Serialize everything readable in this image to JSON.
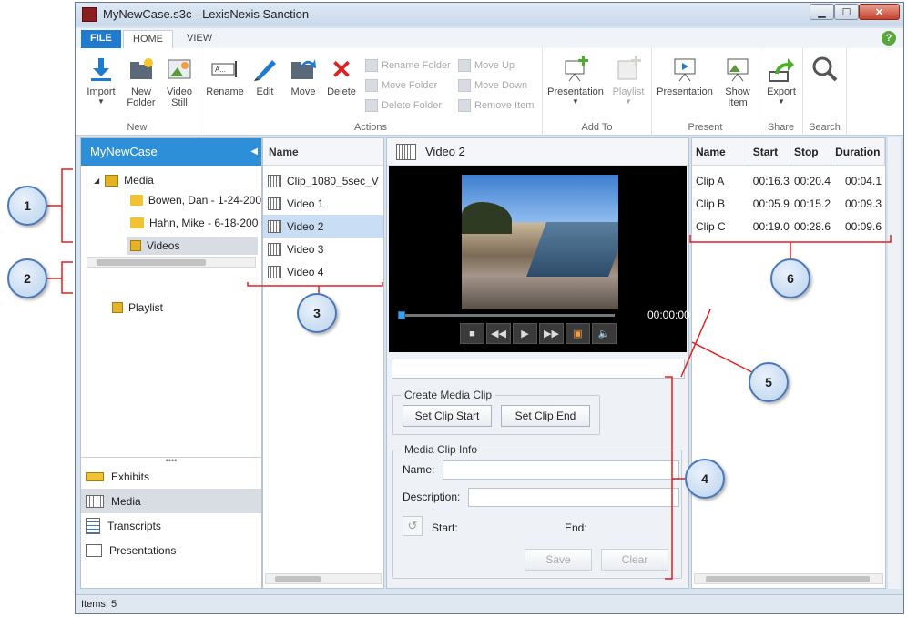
{
  "window": {
    "title": "MyNewCase.s3c - LexisNexis Sanction"
  },
  "tabs": {
    "file": "FILE",
    "home": "HOME",
    "view": "VIEW"
  },
  "ribbon": {
    "new_group": {
      "label": "New",
      "import": "Import",
      "new_folder": "New Folder",
      "video_still": "Video Still"
    },
    "actions_group": {
      "label": "Actions",
      "rename": "Rename",
      "edit": "Edit",
      "move": "Move",
      "delete": "Delete",
      "rename_folder": "Rename Folder",
      "move_folder": "Move Folder",
      "delete_folder": "Delete Folder",
      "move_up": "Move Up",
      "move_down": "Move Down",
      "remove_item": "Remove Item"
    },
    "addto_group": {
      "label": "Add To",
      "presentation": "Presentation",
      "playlist": "Playlist"
    },
    "present_group": {
      "label": "Present",
      "presentation": "Presentation",
      "show_item": "Show Item"
    },
    "share_group": {
      "label": "Share",
      "export": "Export"
    },
    "search_group": {
      "label": "Search"
    }
  },
  "leftnav": {
    "header": "MyNewCase",
    "tree": {
      "media": "Media",
      "folder1": "Bowen, Dan - 1-24-200",
      "folder2": "Hahn, Mike - 6-18-200",
      "videos": "Videos",
      "playlist": "Playlist"
    },
    "bottom": {
      "exhibits": "Exhibits",
      "media": "Media",
      "transcripts": "Transcripts",
      "presentations": "Presentations"
    }
  },
  "filelist": {
    "header": "Name",
    "items": [
      "Clip_1080_5sec_V",
      "Video 1",
      "Video 2",
      "Video 3",
      "Video 4"
    ]
  },
  "player": {
    "title": "Video 2",
    "timecode": "00:00:00",
    "progress": 0.0
  },
  "clip_panel": {
    "create_legend": "Create Media Clip",
    "set_start": "Set Clip Start",
    "set_end": "Set Clip End",
    "info_legend": "Media Clip Info",
    "name_label": "Name:",
    "description_label": "Description:",
    "start_label": "Start:",
    "end_label": "End:",
    "save": "Save",
    "clear": "Clear"
  },
  "clips": {
    "headers": [
      "Name",
      "Start",
      "Stop",
      "Duration"
    ],
    "rows": [
      [
        "Clip A",
        "00:16.3",
        "00:20.4",
        "00:04.1"
      ],
      [
        "Clip B",
        "00:05.9",
        "00:15.2",
        "00:09.3"
      ],
      [
        "Clip C",
        "00:19.0",
        "00:28.6",
        "00:09.6"
      ]
    ]
  },
  "status": {
    "items": "Items: 5"
  },
  "callouts": {
    "c1": "1",
    "c2": "2",
    "c3": "3",
    "c4": "4",
    "c5": "5",
    "c6": "6"
  },
  "colors": {
    "accent": "#2c8fd8",
    "annotation_red": "#e02020",
    "callout_border": "#4a77b8"
  }
}
